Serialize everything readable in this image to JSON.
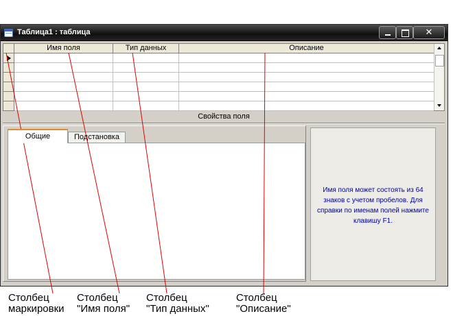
{
  "window": {
    "title": "Таблица1 : таблица",
    "close_glyph": "✕"
  },
  "grid": {
    "columns": [
      "Имя поля",
      "Тип данных",
      "Описание"
    ],
    "row_count": 6
  },
  "properties": {
    "caption": "Свойства поля",
    "tabs": [
      "Общие",
      "Подстановка"
    ],
    "active_tab": "Общие",
    "help_text": "Имя поля может состоять из 64 знаков с учетом пробелов.  Для справки по именам полей нажмите клавишу F1."
  },
  "annotations": [
    {
      "line1": "Столбец",
      "line2": "маркировки"
    },
    {
      "line1": "Столбец",
      "line2": "\"Имя поля\""
    },
    {
      "line1": "Столбец",
      "line2": "\"Тип данных\""
    },
    {
      "line1": "Столбец",
      "line2": "\"Описание\""
    }
  ],
  "colors": {
    "annotation_line": "#e00000",
    "help_text": "#0000a0",
    "active_tab_accent": "#e68b2c"
  }
}
